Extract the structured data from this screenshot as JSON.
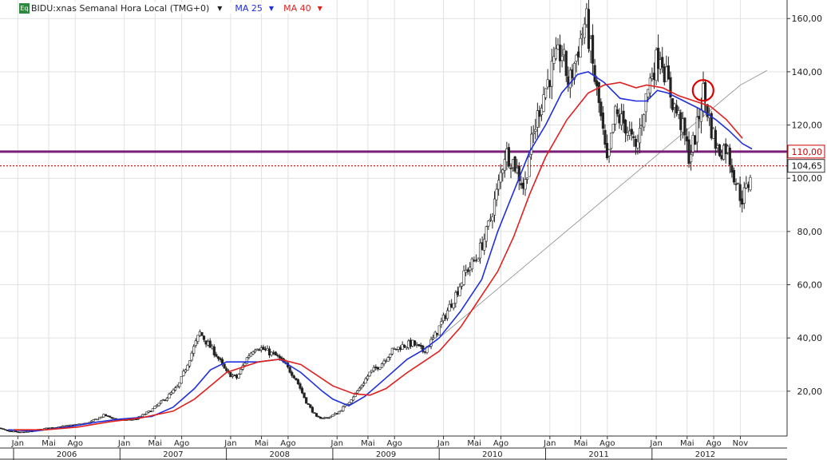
{
  "header": {
    "badge": "Eq",
    "symbol_text": "BIDU:xnas Semanal Hora Local (TMG+0)",
    "dropdown_glyph": "▼",
    "ma1_label": "MA 25",
    "ma2_label": "MA 40",
    "ma1_color": "#1f2fe0",
    "ma2_color": "#e01f1f"
  },
  "colors": {
    "up_candle": "#ffffff",
    "down_candle": "#222222",
    "resistance_line": "#7a1f7a",
    "price_line": "#cc0000",
    "trend_line": "#888888",
    "circle": "#dd0000"
  },
  "chart_data": {
    "type": "candlestick",
    "y_axis": {
      "min": 0,
      "max": 166,
      "ticks": [
        20,
        40,
        60,
        80,
        100,
        120,
        140,
        160
      ],
      "tick_labels": [
        "20,00",
        "40,00",
        "60,00",
        "80,00",
        "100,00",
        "120,00",
        "140,00",
        "160,00"
      ],
      "position": "right"
    },
    "x_axis": {
      "months": [
        {
          "t": 2006.04,
          "label": "Jan"
        },
        {
          "t": 2006.33,
          "label": "Mai"
        },
        {
          "t": 2006.58,
          "label": "Ago"
        },
        {
          "t": 2007.04,
          "label": "Jan"
        },
        {
          "t": 2007.33,
          "label": "Mai"
        },
        {
          "t": 2007.58,
          "label": "Ago"
        },
        {
          "t": 2008.04,
          "label": "Jan"
        },
        {
          "t": 2008.33,
          "label": "Mai"
        },
        {
          "t": 2008.58,
          "label": "Ago"
        },
        {
          "t": 2009.04,
          "label": "Jan"
        },
        {
          "t": 2009.33,
          "label": "Mai"
        },
        {
          "t": 2009.58,
          "label": "Ago"
        },
        {
          "t": 2010.04,
          "label": "Jan"
        },
        {
          "t": 2010.33,
          "label": "Mai"
        },
        {
          "t": 2010.58,
          "label": "Ago"
        },
        {
          "t": 2011.04,
          "label": "Jan"
        },
        {
          "t": 2011.33,
          "label": "Mai"
        },
        {
          "t": 2011.58,
          "label": "Ago"
        },
        {
          "t": 2012.04,
          "label": "Jan"
        },
        {
          "t": 2012.33,
          "label": "Mai"
        },
        {
          "t": 2012.58,
          "label": "Ago"
        },
        {
          "t": 2012.83,
          "label": "Nov"
        }
      ],
      "years": [
        {
          "start": 2006.0,
          "end": 2007.0,
          "label": "2006"
        },
        {
          "start": 2007.0,
          "end": 2008.0,
          "label": "2007"
        },
        {
          "start": 2008.0,
          "end": 2009.0,
          "label": "2008"
        },
        {
          "start": 2009.0,
          "end": 2010.0,
          "label": "2009"
        },
        {
          "start": 2010.0,
          "end": 2011.0,
          "label": "2010"
        },
        {
          "start": 2011.0,
          "end": 2012.0,
          "label": "2011"
        },
        {
          "start": 2012.0,
          "end": 2013.0,
          "label": "2012"
        }
      ]
    },
    "grid": true,
    "price_path": [
      [
        2005.77,
        7
      ],
      [
        2005.95,
        5
      ],
      [
        2006.1,
        4.5
      ],
      [
        2006.3,
        6
      ],
      [
        2006.5,
        7
      ],
      [
        2006.7,
        8
      ],
      [
        2006.85,
        11
      ],
      [
        2007.0,
        9
      ],
      [
        2007.15,
        9.5
      ],
      [
        2007.3,
        13
      ],
      [
        2007.45,
        18
      ],
      [
        2007.55,
        22
      ],
      [
        2007.65,
        32
      ],
      [
        2007.75,
        42
      ],
      [
        2007.82,
        38
      ],
      [
        2007.9,
        34
      ],
      [
        2008.0,
        27
      ],
      [
        2008.1,
        25
      ],
      [
        2008.2,
        33
      ],
      [
        2008.28,
        37
      ],
      [
        2008.38,
        35
      ],
      [
        2008.48,
        33
      ],
      [
        2008.55,
        30
      ],
      [
        2008.65,
        25
      ],
      [
        2008.75,
        16
      ],
      [
        2008.85,
        10
      ],
      [
        2008.95,
        10
      ],
      [
        2009.05,
        12
      ],
      [
        2009.15,
        16
      ],
      [
        2009.25,
        21
      ],
      [
        2009.35,
        27
      ],
      [
        2009.45,
        30
      ],
      [
        2009.55,
        35
      ],
      [
        2009.65,
        37
      ],
      [
        2009.75,
        38
      ],
      [
        2009.85,
        35
      ],
      [
        2009.95,
        40
      ],
      [
        2010.05,
        48
      ],
      [
        2010.15,
        56
      ],
      [
        2010.25,
        65
      ],
      [
        2010.35,
        70
      ],
      [
        2010.45,
        80
      ],
      [
        2010.55,
        96
      ],
      [
        2010.62,
        110
      ],
      [
        2010.7,
        106
      ],
      [
        2010.8,
        96
      ],
      [
        2010.85,
        110
      ],
      [
        2010.95,
        128
      ],
      [
        2011.05,
        140
      ],
      [
        2011.15,
        148
      ],
      [
        2011.22,
        135
      ],
      [
        2011.3,
        148
      ],
      [
        2011.38,
        160
      ],
      [
        2011.45,
        140
      ],
      [
        2011.5,
        128
      ],
      [
        2011.58,
        104
      ],
      [
        2011.65,
        124
      ],
      [
        2011.75,
        120
      ],
      [
        2011.85,
        110
      ],
      [
        2011.92,
        126
      ],
      [
        2012.0,
        140
      ],
      [
        2012.08,
        148
      ],
      [
        2012.12,
        140
      ],
      [
        2012.2,
        128
      ],
      [
        2012.28,
        120
      ],
      [
        2012.35,
        108
      ],
      [
        2012.42,
        118
      ],
      [
        2012.48,
        133
      ],
      [
        2012.55,
        120
      ],
      [
        2012.62,
        110
      ],
      [
        2012.7,
        112
      ],
      [
        2012.78,
        100
      ],
      [
        2012.84,
        92
      ],
      [
        2012.9,
        97
      ],
      [
        2012.94,
        105
      ]
    ],
    "series": [
      {
        "name": "MA 25",
        "color": "#1f2fe0",
        "points": [
          [
            2005.95,
            5.5
          ],
          [
            2006.2,
            5
          ],
          [
            2006.5,
            6.5
          ],
          [
            2006.8,
            8.5
          ],
          [
            2007.0,
            9.5
          ],
          [
            2007.3,
            10.5
          ],
          [
            2007.5,
            14
          ],
          [
            2007.7,
            21
          ],
          [
            2007.85,
            28
          ],
          [
            2008.0,
            31
          ],
          [
            2008.15,
            31
          ],
          [
            2008.3,
            31
          ],
          [
            2008.5,
            32
          ],
          [
            2008.7,
            27
          ],
          [
            2008.9,
            20
          ],
          [
            2009.0,
            17
          ],
          [
            2009.15,
            14.5
          ],
          [
            2009.3,
            18
          ],
          [
            2009.5,
            25
          ],
          [
            2009.7,
            32
          ],
          [
            2009.85,
            35.5
          ],
          [
            2010.0,
            40
          ],
          [
            2010.2,
            50
          ],
          [
            2010.4,
            62
          ],
          [
            2010.55,
            80
          ],
          [
            2010.7,
            95
          ],
          [
            2010.85,
            110
          ],
          [
            2011.0,
            120
          ],
          [
            2011.15,
            132
          ],
          [
            2011.3,
            139
          ],
          [
            2011.4,
            140
          ],
          [
            2011.55,
            136
          ],
          [
            2011.7,
            130
          ],
          [
            2011.85,
            129
          ],
          [
            2011.95,
            129
          ],
          [
            2012.05,
            133
          ],
          [
            2012.15,
            132
          ],
          [
            2012.3,
            129
          ],
          [
            2012.45,
            126
          ],
          [
            2012.6,
            122
          ],
          [
            2012.72,
            118
          ],
          [
            2012.85,
            113
          ],
          [
            2012.94,
            111
          ]
        ]
      },
      {
        "name": "MA 40",
        "color": "#e01f1f",
        "points": [
          [
            2006.0,
            5.5
          ],
          [
            2006.3,
            5.5
          ],
          [
            2006.6,
            6.5
          ],
          [
            2006.9,
            8.5
          ],
          [
            2007.2,
            10
          ],
          [
            2007.5,
            12.5
          ],
          [
            2007.7,
            17
          ],
          [
            2007.85,
            22
          ],
          [
            2008.0,
            27
          ],
          [
            2008.15,
            29
          ],
          [
            2008.3,
            31
          ],
          [
            2008.5,
            32
          ],
          [
            2008.7,
            30
          ],
          [
            2008.85,
            26
          ],
          [
            2009.0,
            22
          ],
          [
            2009.2,
            19
          ],
          [
            2009.35,
            18.5
          ],
          [
            2009.5,
            21
          ],
          [
            2009.7,
            27
          ],
          [
            2009.85,
            31
          ],
          [
            2010.0,
            35
          ],
          [
            2010.2,
            44
          ],
          [
            2010.4,
            56
          ],
          [
            2010.55,
            65
          ],
          [
            2010.7,
            78
          ],
          [
            2010.85,
            94
          ],
          [
            2011.0,
            108
          ],
          [
            2011.2,
            122
          ],
          [
            2011.4,
            132
          ],
          [
            2011.55,
            135
          ],
          [
            2011.7,
            136
          ],
          [
            2011.85,
            134
          ],
          [
            2011.95,
            135
          ],
          [
            2012.1,
            134
          ],
          [
            2012.25,
            131
          ],
          [
            2012.4,
            129
          ],
          [
            2012.55,
            127
          ],
          [
            2012.7,
            122
          ],
          [
            2012.85,
            115
          ]
        ]
      }
    ],
    "horizontal_lines": [
      {
        "value": 110.0,
        "label": "110,00",
        "style": "solid"
      },
      {
        "value": 104.65,
        "label": "104,65",
        "style": "dotted"
      }
    ],
    "trend_lines": [
      {
        "from": [
          2010.0,
          40
        ],
        "to": [
          2012.83,
          135
        ]
      },
      {
        "from": [
          2012.83,
          135
        ],
        "to": [
          2013.08,
          140.5
        ]
      }
    ],
    "annotations": [
      {
        "type": "circle",
        "x": 2012.48,
        "y": 133
      }
    ]
  }
}
